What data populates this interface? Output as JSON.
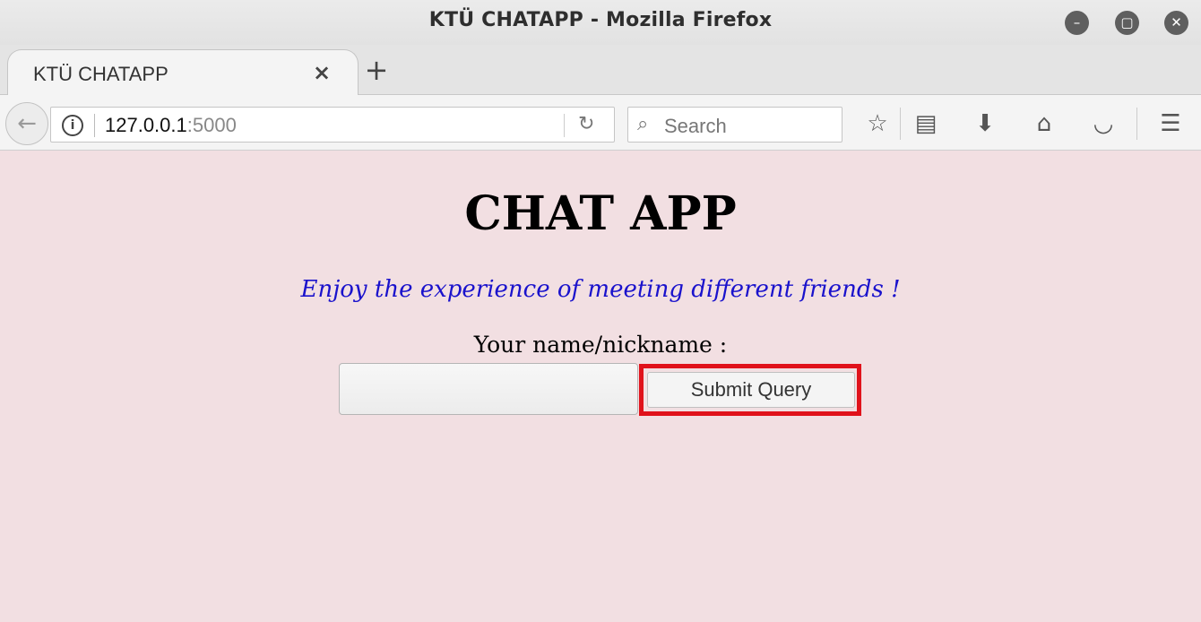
{
  "window": {
    "title": "KTÜ CHATAPP - Mozilla Firefox",
    "buttons": [
      "minimize",
      "maximize",
      "close"
    ]
  },
  "tabs": [
    {
      "label": "KTÜ CHATAPP",
      "active": true
    }
  ],
  "navbar": {
    "url_host": "127.0.0.1",
    "url_port": ":5000",
    "search_placeholder": "Search"
  },
  "page": {
    "heading": "CHAT APP",
    "tagline": "Enjoy the experience of meeting different friends !",
    "name_label": "Your name/nickname :",
    "name_value": "",
    "submit_label": "Submit Query",
    "highlight_color": "#e0121b",
    "background_color": "#f2dfe2",
    "tagline_color": "#1a12cc"
  }
}
